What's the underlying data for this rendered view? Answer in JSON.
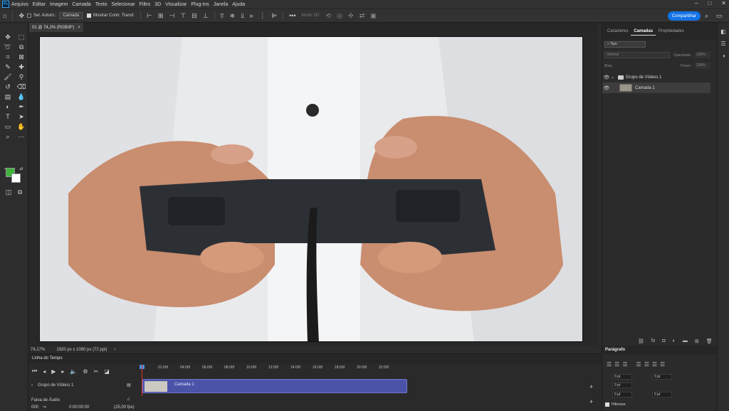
{
  "menubar": {
    "items": [
      "Arquivo",
      "Editar",
      "Imagem",
      "Camada",
      "Texto",
      "Selecionar",
      "Filtro",
      "3D",
      "Visualizar",
      "Plug-ins",
      "Janela",
      "Ajuda"
    ]
  },
  "options": {
    "auto_select_label": "Sel. Autom.:",
    "auto_select_value": "Camada",
    "show_transform_label": "Mostrar Contr. Transf.",
    "mode_3d_label": "Modo 3D:",
    "share_label": "Compartilhar"
  },
  "document": {
    "tab_title": "01 @ 74,2% (RGB/8*)",
    "zoom": "74,17%",
    "info": "1920 px x 1080 px (72 ppi)"
  },
  "timeline": {
    "title": "Linha do Tempo",
    "ticks": [
      "01:00f",
      "04:00f",
      "06:00f",
      "08:00f",
      "10:00f",
      "12:00f",
      "14:00f",
      "16:00f",
      "18:00f",
      "20:00f",
      "22:00f"
    ],
    "group_label": "Grupo de Vídeos 1",
    "clip_label": "Camada 1",
    "audio_label": "Faixa de Áudio",
    "frame": "000",
    "timecode": "0:00:00:00",
    "fps": "(25,00 fps)"
  },
  "layers_panel": {
    "tabs": [
      "Caracteres",
      "Camadas",
      "Propriedades"
    ],
    "active_tab": "Camadas",
    "filter_label": "Tipo",
    "blend_mode": "Normal",
    "opacity_label": "Opacidade:",
    "opacity_value": "100%",
    "lock_label": "Bloq.:",
    "fill_label": "Preen.:",
    "fill_value": "100%",
    "layers": [
      {
        "name": "Grupo de Vídeos 1"
      },
      {
        "name": "Camada 1"
      }
    ]
  },
  "paragraph_panel": {
    "title": "Parágrafo",
    "values": [
      "0 pt",
      "0 pt",
      "0 pt",
      "0 pt",
      "0 pt"
    ],
    "hyphenate_label": "Hifenizar"
  },
  "colors": {
    "foreground": "#3fb33c",
    "background": "#ffffff",
    "accent": "#1473e6",
    "clip": "#4b53a9"
  }
}
